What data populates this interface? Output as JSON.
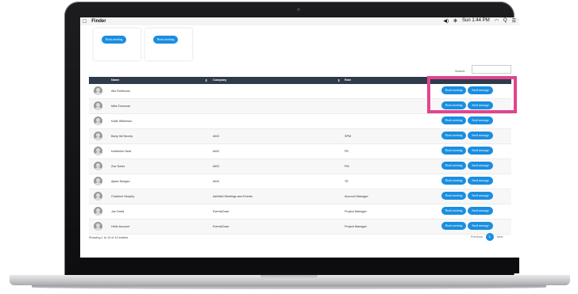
{
  "menubar": {
    "app_name": "Finder",
    "volume": "◀︎)",
    "bluetooth": "✻",
    "clock": "Sun 1:44 PM",
    "wifi": "◠",
    "search": "Q",
    "list": "☰"
  },
  "cards": [
    {
      "label": "Book meeting"
    },
    {
      "label": "Book meeting"
    }
  ],
  "search": {
    "label": "Search:",
    "placeholder": ""
  },
  "table": {
    "headers": {
      "name": "Name",
      "company": "Company",
      "role": "Role"
    },
    "sort_icon": "⇕",
    "actions": {
      "book": "Book meeting",
      "send": "Send message"
    },
    "rows": [
      {
        "name": "Alix Rollesons",
        "company": "",
        "role": ""
      },
      {
        "name": "Mike Donovan",
        "company": "",
        "role": ""
      },
      {
        "name": "Katie Wilkerson",
        "company": "",
        "role": ""
      },
      {
        "name": "Barry McTavney",
        "company": "AMC",
        "role": "SPM"
      },
      {
        "name": "Katherine Neal",
        "company": "AMC",
        "role": "PE"
      },
      {
        "name": "Zoe Davis",
        "company": "AMC",
        "role": "PM"
      },
      {
        "name": "Ajaan Morgan",
        "company": "AMC",
        "role": "TE"
      },
      {
        "name": "Charlene Murphy",
        "company": "Ashfield Meetings and Events",
        "role": "Account Manager"
      },
      {
        "name": "Joe Dodd",
        "company": "EventsCase",
        "role": "Project Manager"
      },
      {
        "name": "Hello Account",
        "company": "EventsCase",
        "role": "Project Manager"
      }
    ]
  },
  "footer": {
    "info": "Showing 1 to 10 of 10 entries",
    "previous": "Previous",
    "page": "1",
    "next": "Next"
  },
  "colors": {
    "accent": "#1a8ee0",
    "header": "#2f3a4a",
    "highlight": "#e0458f"
  }
}
